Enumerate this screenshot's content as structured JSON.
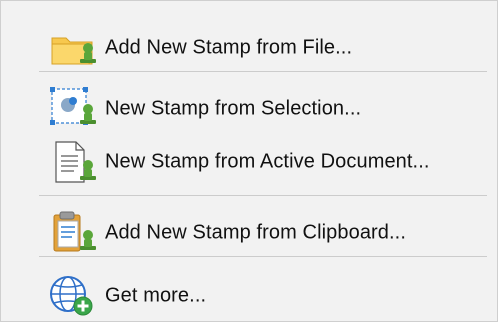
{
  "menu": {
    "items": [
      {
        "label": "Add New Stamp from File...",
        "icon": "folder-stamp-icon"
      },
      {
        "label": "New Stamp from Selection...",
        "icon": "selection-stamp-icon"
      },
      {
        "label": "New Stamp from Active Document...",
        "icon": "document-stamp-icon"
      },
      {
        "label": "Add New Stamp from Clipboard...",
        "icon": "clipboard-stamp-icon"
      },
      {
        "label": "Get more...",
        "icon": "globe-add-icon"
      }
    ]
  },
  "colors": {
    "menu_background": "#f2f2f2",
    "separator": "#cccccc",
    "folder_yellow": "#f5c24c",
    "stamp_green": "#5aa63a",
    "selection_blue": "#2f7dd1",
    "globe_blue": "#2f6fc8",
    "add_green": "#3aa64a"
  }
}
